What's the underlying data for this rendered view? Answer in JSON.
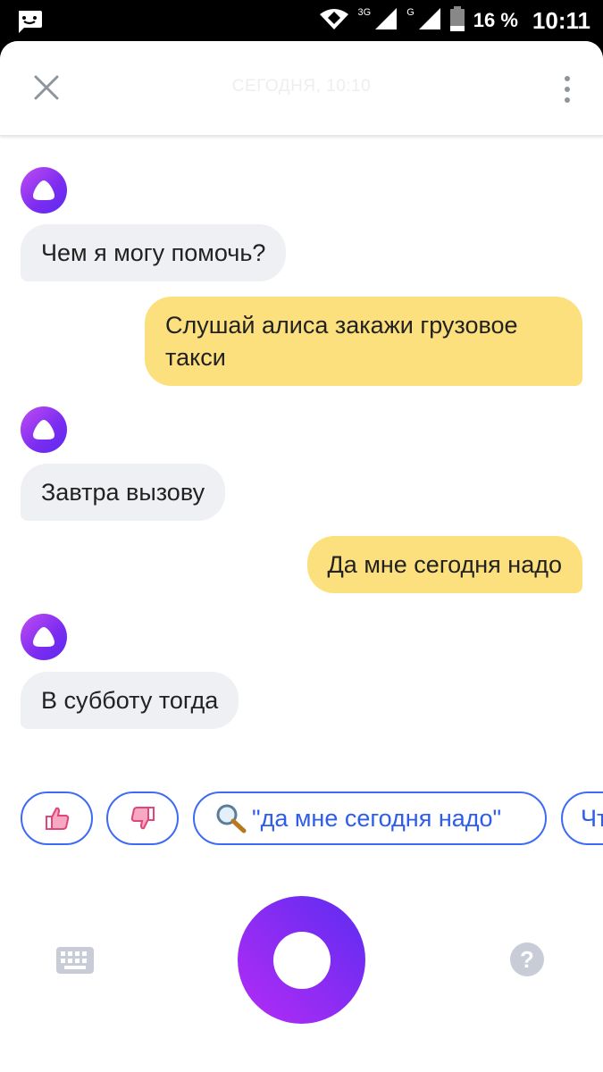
{
  "status_bar": {
    "network_3g": "3G",
    "network_g": "G",
    "battery": "16 %",
    "time": "10:11"
  },
  "header": {
    "title": "СЕГОДНЯ, 10:10",
    "close_icon": "close-icon",
    "menu_icon": "more-vertical-icon"
  },
  "messages": [
    {
      "from": "alice",
      "text": "Чем я могу помочь?"
    },
    {
      "from": "user",
      "text": "Слушай алиса закажи грузовое такси"
    },
    {
      "from": "alice",
      "text": "Завтра вызову"
    },
    {
      "from": "user",
      "text": "Да мне сегодня надо"
    },
    {
      "from": "alice",
      "text": "В субботу тогда"
    }
  ],
  "suggests": {
    "like_icon": "thumbs-up-icon",
    "dislike_icon": "thumbs-down-icon",
    "search_text": "\"да мне сегодня надо\"",
    "next_text": "Чт"
  },
  "colors": {
    "accent": "#3d6bf5",
    "user_bubble": "#fde07e",
    "alice_bubble": "#eef0f3",
    "alice_purple": "#7a2cf0"
  }
}
